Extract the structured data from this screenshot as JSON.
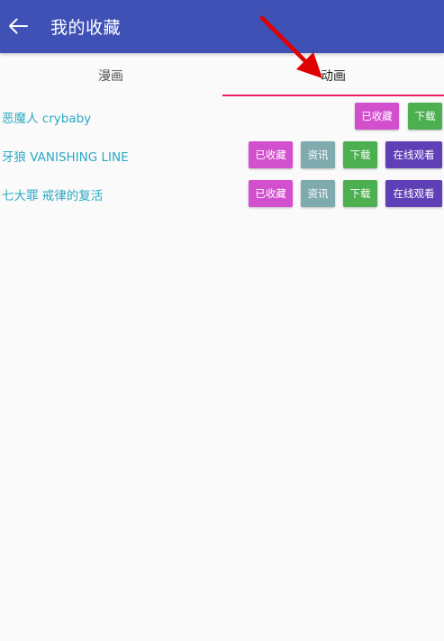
{
  "colors": {
    "appbar": "#3f51b5",
    "tab_indicator": "#e91e63",
    "title_text": "#2aa9c4",
    "favorited_button": "#d24fce",
    "info_button": "#7faaae",
    "download_button": "#4caf50",
    "watch_button": "#5e3fb6",
    "annotation_arrow": "#e00000"
  },
  "appbar": {
    "back_icon": "arrow-left-icon",
    "title": "我的收藏"
  },
  "tabs": [
    {
      "label": "漫画",
      "selected": false
    },
    {
      "label": "动画",
      "selected": true
    }
  ],
  "items": [
    {
      "title": "恶魔人 crybaby",
      "favorited_label": "已收藏",
      "download_label": "下载"
    },
    {
      "title": "牙狼 VANISHING LINE",
      "favorited_label": "已收藏",
      "info_label": "资讯",
      "download_label": "下载",
      "watch_label": "在线观看"
    },
    {
      "title": "七大罪 戒律的复活",
      "favorited_label": "已收藏",
      "info_label": "资讯",
      "download_label": "下载",
      "watch_label": "在线观看"
    }
  ],
  "annotation": {
    "icon": "red-arrow-annotation"
  }
}
